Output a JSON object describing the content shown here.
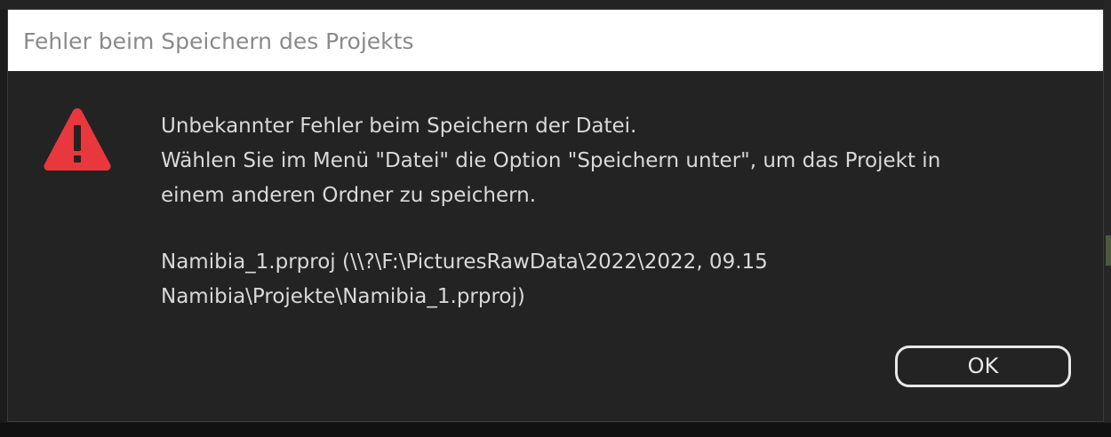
{
  "dialog": {
    "title": "Fehler beim Speichern des Projekts",
    "icon": "warning-icon",
    "icon_color": "#e8383d",
    "message": {
      "line1": "Unbekannter Fehler beim Speichern der Datei.",
      "line2": "Wählen Sie im Menü \"Datei\" die Option \"Speichern unter\", um das Projekt in",
      "line3": "einem anderen Ordner zu speichern.",
      "path_line1": "Namibia_1.prproj (\\\\?\\F:\\PicturesRawData\\2022\\2022, 09.15",
      "path_line2": "Namibia\\Projekte\\Namibia_1.prproj)"
    },
    "ok_label": "OK"
  },
  "colors": {
    "dialog_background": "#232323",
    "title_bar_background": "#ffffff",
    "title_text": "#8a8a8a",
    "message_text": "#d9d9d9",
    "button_border": "#e8e8e8"
  }
}
